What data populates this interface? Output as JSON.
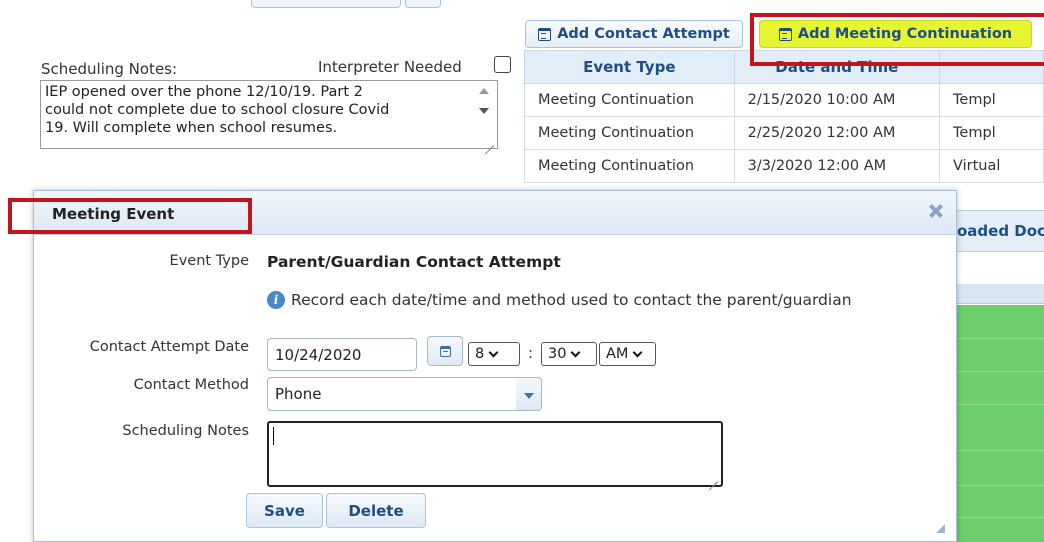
{
  "background": {
    "scheduling_notes_label": "Scheduling Notes:",
    "interpreter_label": "Interpreter Needed",
    "notes_lines": [
      "IEP opened over the phone 12/10/19. Part 2",
      "could not complete due to school closure Covid",
      "19. Will complete when school resumes."
    ],
    "buttons": {
      "add_contact_attempt": "Add Contact Attempt",
      "add_meeting_continuation": "Add Meeting Continuation"
    },
    "table": {
      "headers": [
        "Event Type",
        "Date and Time",
        ""
      ],
      "rows": [
        [
          "Meeting Continuation",
          "2/15/2020 10:00 AM",
          "Templ"
        ],
        [
          "Meeting Continuation",
          "2/25/2020 12:00 AM",
          "Templ"
        ],
        [
          "Meeting Continuation",
          "3/3/2020 12:00 AM",
          "Virtual"
        ]
      ]
    },
    "right_tab_label": "oaded Doc"
  },
  "dialog": {
    "title": "Meeting Event",
    "event_type_label": "Event Type",
    "event_type_value": "Parent/Guardian Contact Attempt",
    "info_text": "Record each date/time and method used to contact the parent/guardian",
    "contact_date_label": "Contact Attempt Date",
    "contact_date_value": "10/24/2020",
    "hour_value": "8",
    "minute_value": "30",
    "ampm_value": "AM",
    "time_separator": ":",
    "contact_method_label": "Contact Method",
    "contact_method_value": "Phone",
    "scheduling_notes_label": "Scheduling Notes",
    "scheduling_notes_value": "",
    "save_label": "Save",
    "delete_label": "Delete"
  },
  "colors": {
    "highlight": "#e6f52f",
    "annotation_red": "#c0151b",
    "header_text": "#1f4e86",
    "green_fill": "#6cce6c"
  }
}
